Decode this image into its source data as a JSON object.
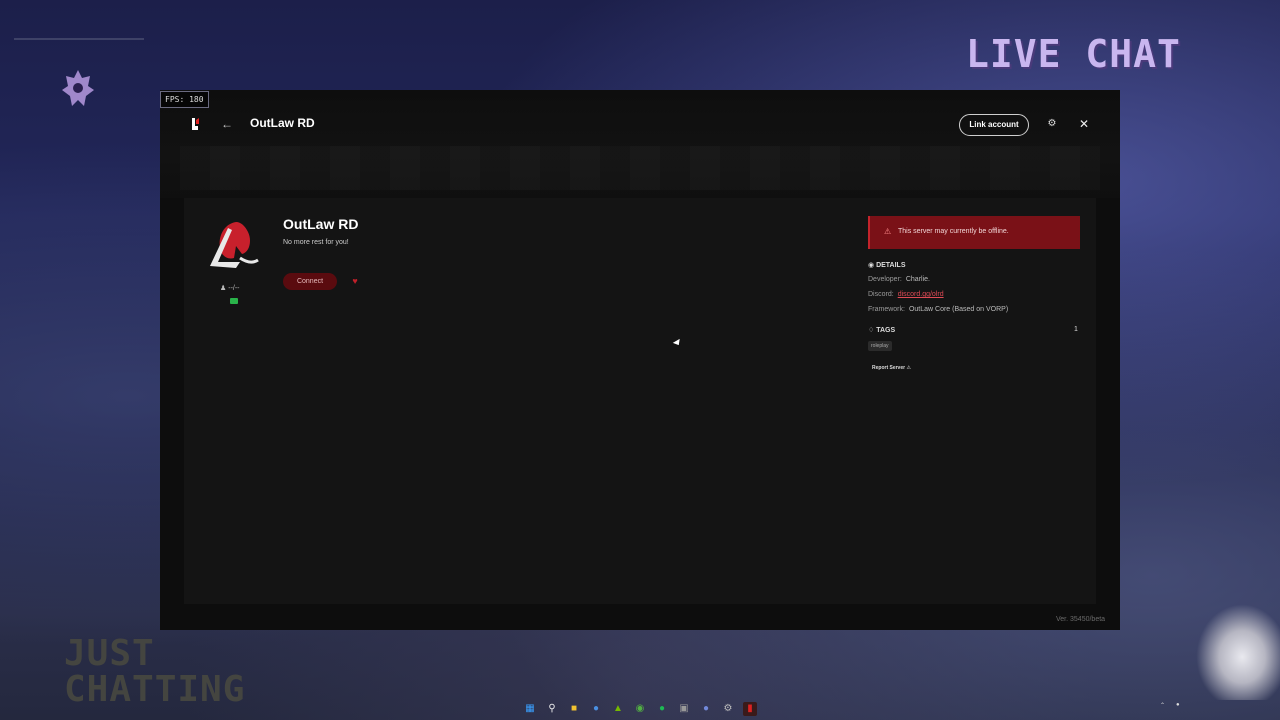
{
  "overlay": {
    "live_chat": "LIVE CHAT",
    "just_chatting_line1": "JUST",
    "just_chatting_line2": "CHATTING",
    "fps": "FPS: 180"
  },
  "window": {
    "title": "OutLaw RD",
    "link_account": "Link account",
    "back_icon": "arrow-left-icon",
    "settings_icon": "gear-icon",
    "close_icon": "close-icon"
  },
  "server": {
    "name": "OutLaw RD",
    "description": "No more rest for you!",
    "players": "--/--",
    "connect_label": "Connect",
    "offline_message": "This server may currently be offline.",
    "details_heading": "DETAILS",
    "details": [
      {
        "label": "Developer:",
        "value": "Charlie."
      },
      {
        "label": "Discord:",
        "value": "discord.gg/olrd"
      },
      {
        "label": "Framework:",
        "value": "OutLaw Core (Based on VORP)"
      }
    ],
    "tags_heading": "TAGS",
    "tags_count": "1",
    "tags": [
      "roleplay"
    ],
    "report_label": "Report Server"
  },
  "footer": {
    "version": "Ver. 35450/beta"
  },
  "colors": {
    "accent_red": "#c4232b",
    "banner_red": "#7a1117",
    "connect_bg": "#5a0b0f",
    "ping_green": "#2ab34a",
    "live_chat_purple": "#c9b6ef"
  },
  "taskbar": {
    "icons": [
      "windows-start-icon",
      "search-icon",
      "file-explorer-icon",
      "chrome-icon",
      "nvidia-icon",
      "xbox-icon",
      "spotify-icon",
      "excel-icon",
      "discord-icon",
      "steam-icon",
      "redm-icon"
    ]
  }
}
